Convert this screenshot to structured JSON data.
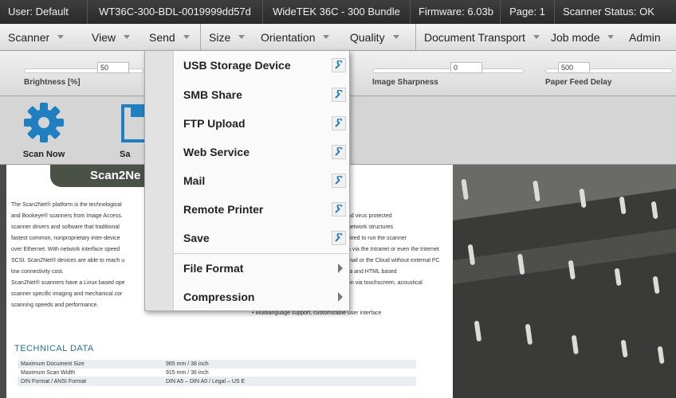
{
  "status": {
    "user": "User: Default",
    "device": "WT36C-300-BDL-0019999dd57d",
    "model": "WideTEK 36C - 300 Bundle",
    "firmware": "Firmware: 6.03b",
    "page": "Page: 1",
    "scanner_status": "Scanner Status: OK"
  },
  "menubar": {
    "items": [
      "Scanner",
      "View",
      "Send",
      "Size",
      "Orientation",
      "Quality",
      "Document Transport",
      "Job mode",
      "Admin"
    ]
  },
  "sliders": {
    "brightness": {
      "label": "Brightness [%]",
      "value": "50",
      "level": 0.5
    },
    "sharpness": {
      "label": "Image Sharpness",
      "value": "0",
      "level": 0.5
    },
    "feed_delay": {
      "label": "Paper Feed Delay",
      "value": "500",
      "level": 0.5
    }
  },
  "toolbar": {
    "scan_now": "Scan Now",
    "save": "Sa"
  },
  "send_menu": {
    "items": [
      {
        "label": "USB Storage Device",
        "icon": "wrench-icon"
      },
      {
        "label": "SMB Share",
        "icon": "wrench-icon"
      },
      {
        "label": "FTP Upload",
        "icon": "wrench-icon"
      },
      {
        "label": "Web Service",
        "icon": "wrench-icon"
      },
      {
        "label": "Mail",
        "icon": "wrench-icon"
      },
      {
        "label": "Remote Printer",
        "icon": "wrench-icon"
      },
      {
        "label": "Save",
        "icon": "wrench-icon"
      },
      {
        "label": "File Format",
        "icon": "submenu-arrow-icon"
      },
      {
        "label": "Compression",
        "icon": "submenu-arrow-icon"
      }
    ]
  },
  "document": {
    "banner": "Scan2Ne",
    "left_lines": [
      "The Scan2Net® platform is the technological",
      "and Bookeye® scanners from Image Access.",
      "scanner drivers and software that traditional",
      "fastest common, nonproprietary inter-device",
      "over Ethernet.  With network interface speed",
      "SCSI. Scan2Net® devices are able to reach u",
      "low connectivity cost.",
      "Scan2Net® scanners have a Linux based ope",
      "scanner specific imaging and mechanical cor",
      "scanning speeds and performance."
    ],
    "right_lines": [
      "nd virus protected",
      "network structures",
      "uired to run the scanner",
      "n via the Intranet or even the Internet",
      "mail or the Cloud without external PC",
      "ra and HTML based",
      "on via touchscreen, acoustical",
      "•    Multilanguage support, customizable user interface"
    ],
    "tech_heading": "TECHNICAL DATA",
    "tech_rows": [
      {
        "k": "Maximum Document Size",
        "v": "965 mm / 38 inch"
      },
      {
        "k": "Maximum Scan Width",
        "v": "915 mm / 36 inch"
      },
      {
        "k": "DIN Format / ANSI Format",
        "v": "DIN A5 – DIN A0 / Legal – US E"
      }
    ]
  },
  "colors": {
    "accent": "#2a6ea0",
    "banner": "#4a5248",
    "gear": "#1f7fc0"
  }
}
